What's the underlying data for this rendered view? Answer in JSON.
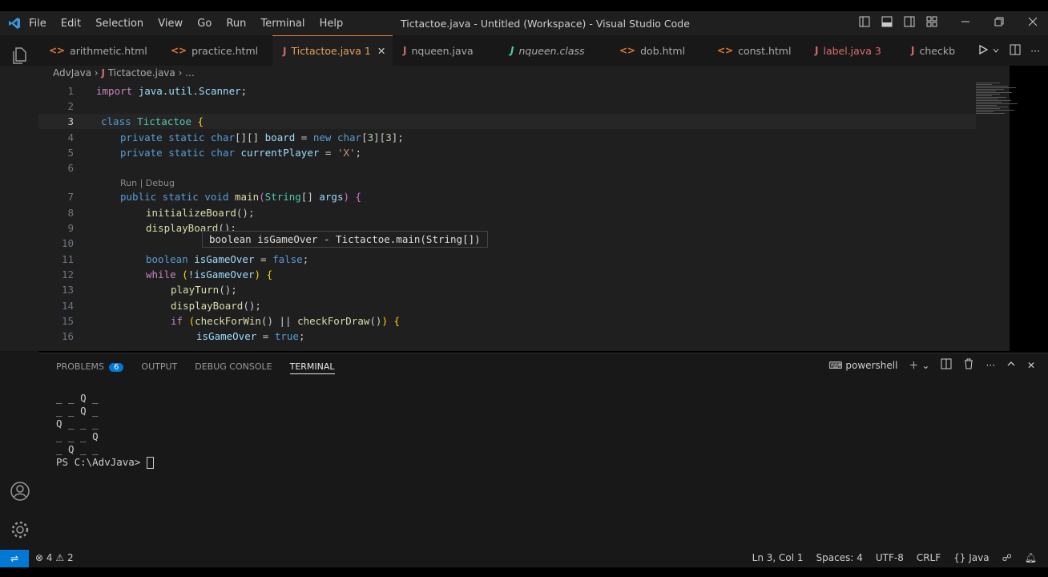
{
  "window": {
    "title": "Tictactoe.java - Untitled (Workspace) - Visual Studio Code",
    "menu": [
      "File",
      "Edit",
      "Selection",
      "View",
      "Go",
      "Run",
      "Terminal",
      "Help"
    ]
  },
  "tabs": [
    {
      "label": "arithmetic.html",
      "type": "html"
    },
    {
      "label": "practice.html",
      "type": "html"
    },
    {
      "label": "Tictactoe.java",
      "suffix": "1",
      "type": "java",
      "active": true
    },
    {
      "label": "nqueen.java",
      "type": "java"
    },
    {
      "label": "nqueen.class",
      "type": "java"
    },
    {
      "label": "dob.html",
      "type": "html"
    },
    {
      "label": "const.html",
      "type": "html"
    },
    {
      "label": "label.java",
      "suffix": "3",
      "type": "java"
    },
    {
      "label": "checkb",
      "type": "java"
    }
  ],
  "breadcrumb": {
    "folder": "AdvJava",
    "file": "Tictactoe.java",
    "more": "..."
  },
  "editor": {
    "line_numbers": [
      "1",
      "2",
      "3",
      "4",
      "5",
      "6",
      "7",
      "8",
      "9",
      "10",
      "11",
      "12",
      "13",
      "14",
      "15",
      "16"
    ],
    "codelens": "Run | Debug",
    "hover": "boolean isGameOver - Tictactoe.main(String[])",
    "lines": [
      "import java.util.Scanner;",
      "",
      "class Tictactoe {",
      "private static char[][] board = new char[3][3];",
      "private static char currentPlayer = 'X';",
      "",
      "public static void main(String[] args) {",
      "initializeBoard();",
      "displayBoard();",
      "",
      "boolean isGameOver = false;",
      "while (!isGameOver) {",
      "playTurn();",
      "displayBoard();",
      "if (checkForWin() || checkForDraw()) {",
      "isGameOver = true;"
    ]
  },
  "panel": {
    "tabs": [
      "PROBLEMS",
      "OUTPUT",
      "DEBUG CONSOLE",
      "TERMINAL"
    ],
    "problems_count": "6",
    "active_tab": "TERMINAL",
    "shell": "powershell",
    "terminal_lines": [
      "_ _ Q _",
      "_ _ Q _",
      "Q _ _ _",
      "_ _ _ Q",
      "_ Q _ _",
      "PS C:\\AdvJava> "
    ]
  },
  "status": {
    "errors": "4",
    "warnings": "2",
    "position": "Ln 3, Col 1",
    "spaces": "Spaces: 4",
    "encoding": "UTF-8",
    "eol": "CRLF",
    "language": "Java"
  },
  "colors": {
    "accent": "#0078d4",
    "active_tab": "#e07b3b"
  }
}
